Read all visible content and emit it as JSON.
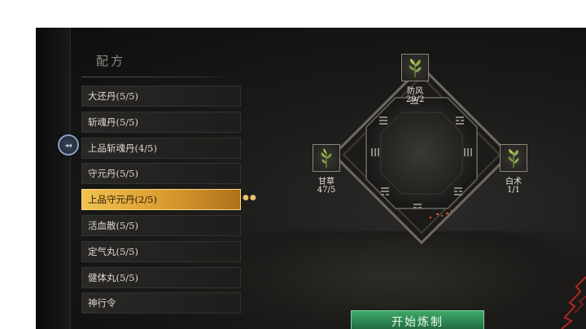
{
  "panel": {
    "title": "配方"
  },
  "recipes": [
    {
      "label": "大还丹(5/5)"
    },
    {
      "label": "斩魂丹(5/5)"
    },
    {
      "label": "上品斩魂丹(4/5)"
    },
    {
      "label": "守元丹(5/5)"
    },
    {
      "label": "上品守元丹(2/5)"
    },
    {
      "label": "活血散(5/5)"
    },
    {
      "label": "定气丸(5/5)"
    },
    {
      "label": "健体丸(5/5)"
    },
    {
      "label": "神行令"
    }
  ],
  "selected_recipe_index": 4,
  "ingredients": {
    "top": {
      "name": "防风",
      "count": "29/2"
    },
    "left": {
      "name": "甘草",
      "count": "47/5"
    },
    "right": {
      "name": "白术",
      "count": "1/1"
    }
  },
  "start_button": {
    "label": "开始炼制"
  },
  "colors": {
    "selected_gold": "#e6aa3c",
    "button_green": "#2a7e4c",
    "text_light": "#ddd8cf"
  },
  "icons": {
    "side_toggle": "collapse-arrow-icon",
    "herb": "herb-icon",
    "trigram": "trigram-icon"
  }
}
